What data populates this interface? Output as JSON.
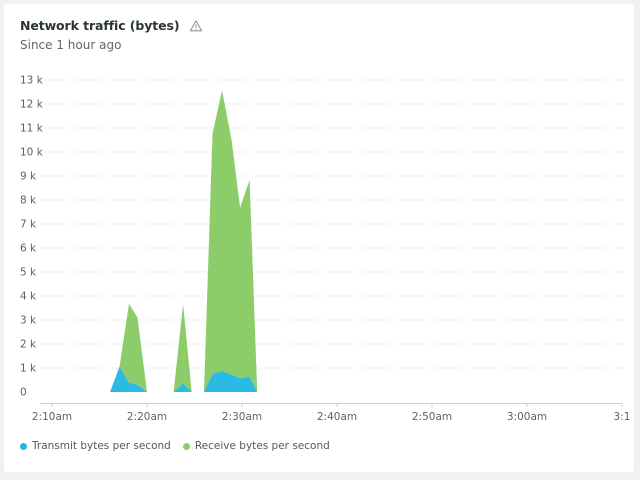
{
  "card": {
    "title": "Network traffic (bytes)",
    "subtitle": "Since 1 hour ago",
    "warning_icon": "warning-triangle-icon"
  },
  "colors": {
    "transmit": "#21b5e1",
    "receive": "#8ccd69",
    "grid": "#d3d8d8",
    "axis": "#c9d0d0",
    "tick_text": "#5b6464"
  },
  "chart_data": {
    "type": "area",
    "stacked": true,
    "grid": true,
    "legend_position": "bottom-left",
    "xlabel": "",
    "ylabel": "",
    "x_ticks": [
      {
        "minute": 10,
        "label": "2:10am"
      },
      {
        "minute": 20,
        "label": "2:20am"
      },
      {
        "minute": 30,
        "label": "2:30am"
      },
      {
        "minute": 40,
        "label": "2:40am"
      },
      {
        "minute": 50,
        "label": "2:50am"
      },
      {
        "minute": 60,
        "label": "3:00am"
      },
      {
        "minute": 70,
        "label": "3:1"
      }
    ],
    "xlim": [
      8,
      70
    ],
    "ylim": [
      0,
      13000
    ],
    "y_ticks": [
      {
        "value": 0,
        "label": "0"
      },
      {
        "value": 1000,
        "label": "1 k"
      },
      {
        "value": 2000,
        "label": "2 k"
      },
      {
        "value": 3000,
        "label": "3 k"
      },
      {
        "value": 4000,
        "label": "4 k"
      },
      {
        "value": 5000,
        "label": "5 k"
      },
      {
        "value": 6000,
        "label": "6 k"
      },
      {
        "value": 7000,
        "label": "7 k"
      },
      {
        "value": 8000,
        "label": "8 k"
      },
      {
        "value": 9000,
        "label": "9 k"
      },
      {
        "value": 10000,
        "label": "10 k"
      },
      {
        "value": 11000,
        "label": "11 k"
      },
      {
        "value": 12000,
        "label": "12 k"
      },
      {
        "value": 13000,
        "label": "13 k"
      }
    ],
    "x": [
      16.1,
      17.1,
      18.1,
      19.0,
      20.0,
      20.1,
      22.8,
      23.8,
      24.7,
      24.8,
      26.0,
      26.9,
      27.9,
      28.9,
      29.8,
      30.8,
      31.6,
      31.7
    ],
    "series": [
      {
        "name": "Transmit bytes per second",
        "color": "#21b5e1",
        "values": [
          0,
          1050,
          380,
          300,
          0,
          0,
          0,
          360,
          0,
          0,
          0,
          750,
          870,
          720,
          580,
          640,
          0,
          0
        ]
      },
      {
        "name": "Receive bytes per second",
        "color": "#8ccd69",
        "values": [
          0,
          0,
          3300,
          2800,
          0,
          0,
          0,
          3300,
          0,
          0,
          0,
          10000,
          11700,
          9800,
          7100,
          8200,
          0,
          0
        ]
      }
    ]
  }
}
